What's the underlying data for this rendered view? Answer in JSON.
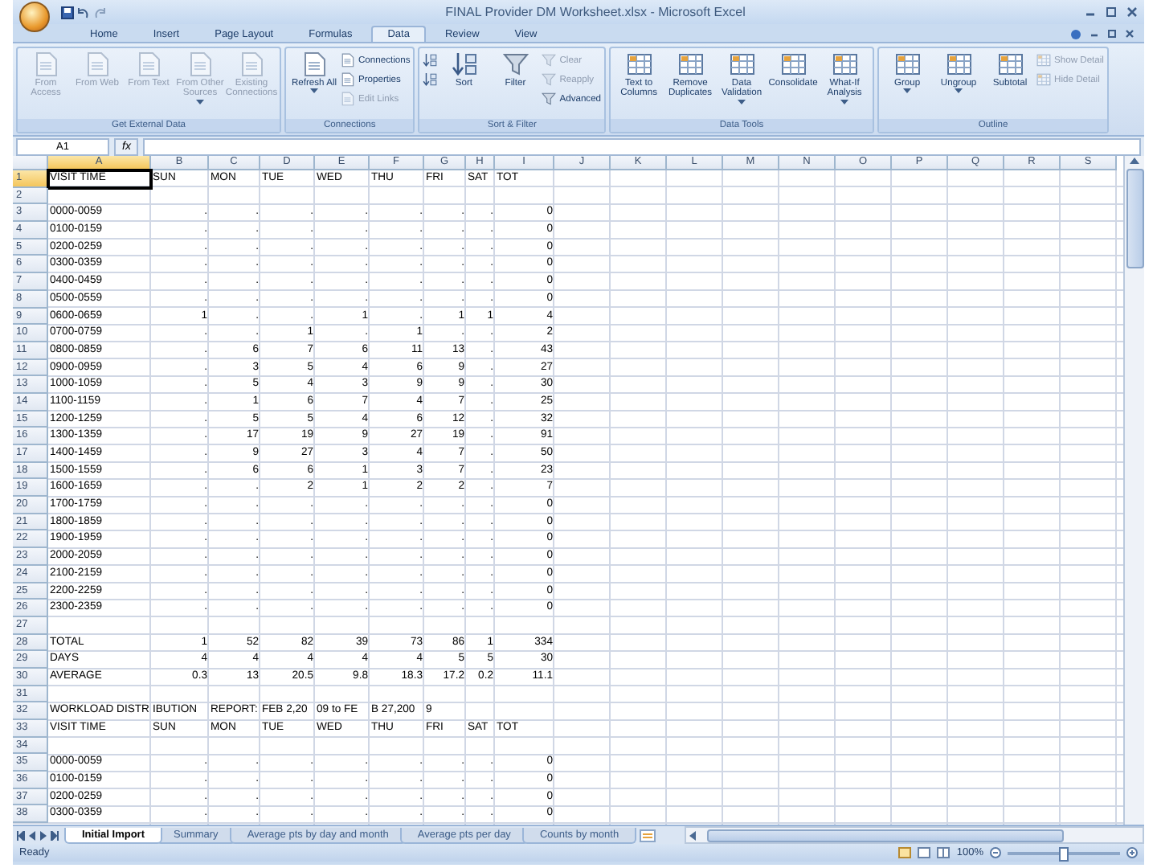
{
  "window": {
    "title": "FINAL Provider DM Worksheet.xlsx - Microsoft Excel"
  },
  "ribbon_tabs": [
    {
      "label": "Home",
      "selected": false
    },
    {
      "label": "Insert",
      "selected": false
    },
    {
      "label": "Page Layout",
      "selected": false
    },
    {
      "label": "Formulas",
      "selected": false
    },
    {
      "label": "Data",
      "selected": true
    },
    {
      "label": "Review",
      "selected": false
    },
    {
      "label": "View",
      "selected": false
    }
  ],
  "ribbon_groups": [
    {
      "title": "Get External Data",
      "buttons": [
        {
          "label": "From Access",
          "kind": "large",
          "disabled": true
        },
        {
          "label": "From Web",
          "kind": "large",
          "disabled": true
        },
        {
          "label": "From Text",
          "kind": "large",
          "disabled": true
        },
        {
          "label": "From Other Sources",
          "kind": "large",
          "disabled": true,
          "dropdown": true
        },
        {
          "label": "Existing Connections",
          "kind": "large",
          "disabled": true
        }
      ]
    },
    {
      "title": "Connections",
      "buttons": [
        {
          "label": "Refresh All",
          "kind": "large",
          "disabled": false,
          "dropdown": true
        },
        {
          "label": "Connections",
          "kind": "small",
          "disabled": false
        },
        {
          "label": "Properties",
          "kind": "small",
          "disabled": false
        },
        {
          "label": "Edit Links",
          "kind": "small",
          "disabled": true
        }
      ]
    },
    {
      "title": "Sort & Filter",
      "buttons": [
        {
          "kind": "icon",
          "disabled": false
        },
        {
          "kind": "icon",
          "disabled": false
        },
        {
          "label": "Sort",
          "kind": "large",
          "disabled": false
        },
        {
          "label": "Filter",
          "kind": "large",
          "disabled": false
        },
        {
          "label": "Clear",
          "kind": "small",
          "disabled": true
        },
        {
          "label": "Reapply",
          "kind": "small",
          "disabled": true
        },
        {
          "label": "Advanced",
          "kind": "small",
          "disabled": false
        }
      ]
    },
    {
      "title": "Data Tools",
      "buttons": [
        {
          "label": "Text to Columns",
          "kind": "large",
          "disabled": false
        },
        {
          "label": "Remove Duplicates",
          "kind": "large",
          "disabled": false
        },
        {
          "label": "Data Validation",
          "kind": "large",
          "disabled": false,
          "dropdown": true
        },
        {
          "label": "Consolidate",
          "kind": "large",
          "disabled": false
        },
        {
          "label": "What-If Analysis",
          "kind": "large",
          "disabled": false,
          "dropdown": true
        }
      ]
    },
    {
      "title": "Outline",
      "buttons": [
        {
          "label": "Group",
          "kind": "large",
          "disabled": false,
          "dropdown": true
        },
        {
          "label": "Ungroup",
          "kind": "large",
          "disabled": false,
          "dropdown": true
        },
        {
          "label": "Subtotal",
          "kind": "large",
          "disabled": false
        },
        {
          "label": "Show Detail",
          "kind": "small",
          "disabled": true
        },
        {
          "label": "Hide Detail",
          "kind": "small",
          "disabled": true
        }
      ]
    }
  ],
  "formula_bar": {
    "name_box": "A1",
    "function_label": "fx"
  },
  "sheet": {
    "columns": [
      {
        "label": "A",
        "selected": true
      },
      {
        "label": "B",
        "selected": false
      },
      {
        "label": "C",
        "selected": false
      },
      {
        "label": "D",
        "selected": false
      },
      {
        "label": "E",
        "selected": false
      },
      {
        "label": "F",
        "selected": false
      },
      {
        "label": "G",
        "selected": false
      },
      {
        "label": "H",
        "selected": false
      },
      {
        "label": "I",
        "selected": false
      },
      {
        "label": "J",
        "selected": false
      },
      {
        "label": "K",
        "selected": false
      },
      {
        "label": "L",
        "selected": false
      },
      {
        "label": "M",
        "selected": false
      },
      {
        "label": "N",
        "selected": false
      },
      {
        "label": "O",
        "selected": false
      },
      {
        "label": "P",
        "selected": false
      },
      {
        "label": "Q",
        "selected": false
      },
      {
        "label": "R",
        "selected": false
      },
      {
        "label": "S",
        "selected": false
      }
    ],
    "rows": [
      {
        "number": "1",
        "kind": "text",
        "selected": true,
        "cells": [
          "VISIT TIME",
          "SUN",
          "MON",
          "TUE",
          "WED",
          "THU",
          "FRI",
          "SAT",
          "TOT"
        ]
      },
      {
        "number": "2",
        "kind": "blank",
        "selected": false
      },
      {
        "number": "3",
        "kind": "data",
        "selected": false,
        "cells": [
          "0000-0059",
          ".",
          ".",
          ".",
          ".",
          ".",
          ".",
          ".",
          "0"
        ]
      },
      {
        "number": "4",
        "kind": "data",
        "selected": false,
        "cells": [
          "0100-0159",
          ".",
          ".",
          ".",
          ".",
          ".",
          ".",
          ".",
          "0"
        ]
      },
      {
        "number": "5",
        "kind": "data",
        "selected": false,
        "cells": [
          "0200-0259",
          ".",
          ".",
          ".",
          ".",
          ".",
          ".",
          ".",
          "0"
        ]
      },
      {
        "number": "6",
        "kind": "data",
        "selected": false,
        "cells": [
          "0300-0359",
          ".",
          ".",
          ".",
          ".",
          ".",
          ".",
          ".",
          "0"
        ]
      },
      {
        "number": "7",
        "kind": "data",
        "selected": false,
        "cells": [
          "0400-0459",
          ".",
          ".",
          ".",
          ".",
          ".",
          ".",
          ".",
          "0"
        ]
      },
      {
        "number": "8",
        "kind": "data",
        "selected": false,
        "cells": [
          "0500-0559",
          ".",
          ".",
          ".",
          ".",
          ".",
          ".",
          ".",
          "0"
        ]
      },
      {
        "number": "9",
        "kind": "data",
        "selected": false,
        "cells": [
          "0600-0659",
          "1",
          ".",
          ".",
          "1",
          ".",
          "1",
          "1",
          "4"
        ]
      },
      {
        "number": "10",
        "kind": "data",
        "selected": false,
        "cells": [
          "0700-0759",
          ".",
          ".",
          "1",
          ".",
          "1",
          ".",
          ".",
          "2"
        ]
      },
      {
        "number": "11",
        "kind": "data",
        "selected": false,
        "cells": [
          "0800-0859",
          ".",
          "6",
          "7",
          "6",
          "11",
          "13",
          ".",
          "43"
        ]
      },
      {
        "number": "12",
        "kind": "data",
        "selected": false,
        "cells": [
          "0900-0959",
          ".",
          "3",
          "5",
          "4",
          "6",
          "9",
          ".",
          "27"
        ]
      },
      {
        "number": "13",
        "kind": "data",
        "selected": false,
        "cells": [
          "1000-1059",
          ".",
          "5",
          "4",
          "3",
          "9",
          "9",
          ".",
          "30"
        ]
      },
      {
        "number": "14",
        "kind": "data",
        "selected": false,
        "cells": [
          "1100-1159",
          ".",
          "1",
          "6",
          "7",
          "4",
          "7",
          ".",
          "25"
        ]
      },
      {
        "number": "15",
        "kind": "data",
        "selected": false,
        "cells": [
          "1200-1259",
          ".",
          "5",
          "5",
          "4",
          "6",
          "12",
          ".",
          "32"
        ]
      },
      {
        "number": "16",
        "kind": "data",
        "selected": false,
        "cells": [
          "1300-1359",
          ".",
          "17",
          "19",
          "9",
          "27",
          "19",
          ".",
          "91"
        ]
      },
      {
        "number": "17",
        "kind": "data",
        "selected": false,
        "cells": [
          "1400-1459",
          ".",
          "9",
          "27",
          "3",
          "4",
          "7",
          ".",
          "50"
        ]
      },
      {
        "number": "18",
        "kind": "data",
        "selected": false,
        "cells": [
          "1500-1559",
          ".",
          "6",
          "6",
          "1",
          "3",
          "7",
          ".",
          "23"
        ]
      },
      {
        "number": "19",
        "kind": "data",
        "selected": false,
        "cells": [
          "1600-1659",
          ".",
          ".",
          "2",
          "1",
          "2",
          "2",
          ".",
          "7"
        ]
      },
      {
        "number": "20",
        "kind": "data",
        "selected": false,
        "cells": [
          "1700-1759",
          ".",
          ".",
          ".",
          ".",
          ".",
          ".",
          ".",
          "0"
        ]
      },
      {
        "number": "21",
        "kind": "data",
        "selected": false,
        "cells": [
          "1800-1859",
          ".",
          ".",
          ".",
          ".",
          ".",
          ".",
          ".",
          "0"
        ]
      },
      {
        "number": "22",
        "kind": "data",
        "selected": false,
        "cells": [
          "1900-1959",
          ".",
          ".",
          ".",
          ".",
          ".",
          ".",
          ".",
          "0"
        ]
      },
      {
        "number": "23",
        "kind": "data",
        "selected": false,
        "cells": [
          "2000-2059",
          ".",
          ".",
          ".",
          ".",
          ".",
          ".",
          ".",
          "0"
        ]
      },
      {
        "number": "24",
        "kind": "data",
        "selected": false,
        "cells": [
          "2100-2159",
          ".",
          ".",
          ".",
          ".",
          ".",
          ".",
          ".",
          "0"
        ]
      },
      {
        "number": "25",
        "kind": "data",
        "selected": false,
        "cells": [
          "2200-2259",
          ".",
          ".",
          ".",
          ".",
          ".",
          ".",
          ".",
          "0"
        ]
      },
      {
        "number": "26",
        "kind": "data",
        "selected": false,
        "cells": [
          "2300-2359",
          ".",
          ".",
          ".",
          ".",
          ".",
          ".",
          ".",
          "0"
        ]
      },
      {
        "number": "27",
        "kind": "blank",
        "selected": false
      },
      {
        "number": "28",
        "kind": "data",
        "selected": false,
        "cells": [
          "TOTAL",
          "1",
          "52",
          "82",
          "39",
          "73",
          "86",
          "1",
          "334"
        ]
      },
      {
        "number": "29",
        "kind": "data",
        "selected": false,
        "cells": [
          "DAYS",
          "4",
          "4",
          "4",
          "4",
          "4",
          "5",
          "5",
          "30"
        ]
      },
      {
        "number": "30",
        "kind": "data",
        "selected": false,
        "cells": [
          "AVERAGE",
          "0.3",
          "13",
          "20.5",
          "9.8",
          "18.3",
          "17.2",
          "0.2",
          "11.1"
        ]
      },
      {
        "number": "31",
        "kind": "blank",
        "selected": false
      },
      {
        "number": "32",
        "kind": "text",
        "selected": false,
        "cells": [
          "WORKLOAD DISTR",
          "IBUTION",
          "REPORT:",
          "FEB 2,20",
          "09 to FE",
          "B 27,200",
          "9"
        ]
      },
      {
        "number": "33",
        "kind": "text",
        "selected": false,
        "cells": [
          "VISIT TIME",
          "SUN",
          "MON",
          "TUE",
          "WED",
          "THU",
          "FRI",
          "SAT",
          "TOT"
        ]
      },
      {
        "number": "34",
        "kind": "blank",
        "selected": false
      },
      {
        "number": "35",
        "kind": "data",
        "selected": false,
        "cells": [
          "0000-0059",
          ".",
          ".",
          ".",
          ".",
          ".",
          ".",
          ".",
          "0"
        ]
      },
      {
        "number": "36",
        "kind": "data",
        "selected": false,
        "cells": [
          "0100-0159",
          ".",
          ".",
          ".",
          ".",
          ".",
          ".",
          ".",
          "0"
        ]
      },
      {
        "number": "37",
        "kind": "data",
        "selected": false,
        "cells": [
          "0200-0259",
          ".",
          ".",
          ".",
          ".",
          ".",
          ".",
          ".",
          "0"
        ]
      },
      {
        "number": "38",
        "kind": "data",
        "selected": false,
        "cells": [
          "0300-0359",
          ".",
          ".",
          ".",
          ".",
          ".",
          ".",
          ".",
          "0"
        ]
      }
    ]
  },
  "sheet_tabs": [
    {
      "label": "Initial Import",
      "selected": true
    },
    {
      "label": "Summary",
      "selected": false
    },
    {
      "label": "Average pts by day and month",
      "selected": false
    },
    {
      "label": "Average pts per day",
      "selected": false
    },
    {
      "label": "Counts by month",
      "selected": false
    }
  ],
  "status_bar": {
    "status": "Ready",
    "zoom": "100%",
    "zoom_slider": {
      "level": 0.5
    }
  }
}
